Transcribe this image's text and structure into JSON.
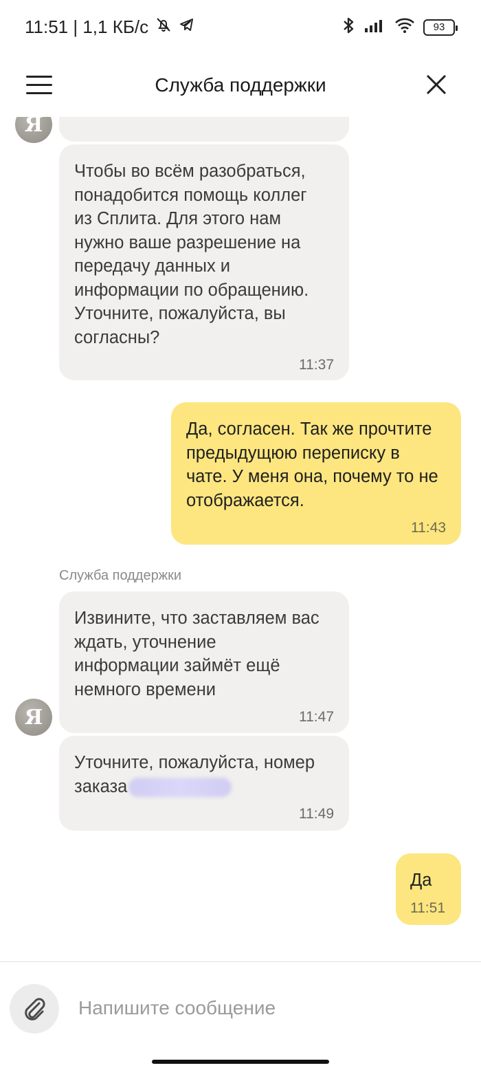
{
  "status_bar": {
    "time_speed": "11:51 | 1,1 КБ/с",
    "battery": "93",
    "icons": [
      "mute-bell-icon",
      "telegram-icon",
      "bluetooth-icon",
      "signal-icon",
      "wifi-icon",
      "battery-icon"
    ]
  },
  "header": {
    "title": "Служба поддержки",
    "menu_icon": "hamburger-menu-icon",
    "close_icon": "close-icon"
  },
  "avatar": {
    "letter": "Я"
  },
  "messages": [
    {
      "direction": "in",
      "text": "Чтобы во всём разобраться,\nпонадобится помощь коллег\nиз Сплита. Для этого нам\nнужно ваше разрешение на\nпередачу данных и\nинформации по обращению.\nУточните, пожалуйста, вы\nсогласны?",
      "time": "11:37"
    },
    {
      "direction": "out",
      "text": "Да, согласен. Так же прочтите\nпредыдущюю переписку в\nчате. У меня она, почему то не\nотображается.",
      "time": "11:43"
    },
    {
      "direction": "in",
      "sender": "Служба поддержки",
      "text": "Извините, что заставляем вас\nждать, уточнение\nинформации займёт ещё\nнемного времени",
      "time": "11:47"
    },
    {
      "direction": "in",
      "text_line1": "Уточните, пожалуйста, номер",
      "text_line2": "заказа",
      "redacted": true,
      "time": "11:49"
    },
    {
      "direction": "out",
      "text": "Да",
      "time": "11:51"
    }
  ],
  "composer": {
    "placeholder": "Напишите сообщение",
    "value": "",
    "attach_icon": "paperclip-icon"
  },
  "colors": {
    "incoming_bubble": "#f1f0ee",
    "outgoing_bubble": "#fde67f",
    "background": "#ffffff"
  }
}
